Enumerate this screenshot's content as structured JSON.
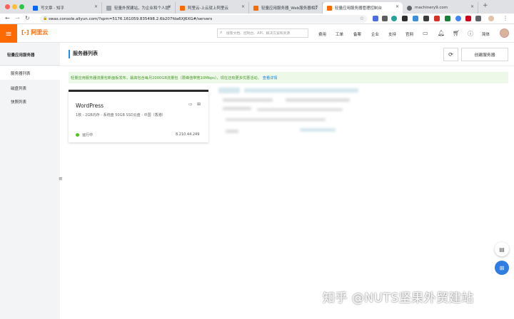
{
  "browser": {
    "tabs": [
      {
        "label": "写文章 - 知乎",
        "fav": "#0066ff"
      },
      {
        "label": "轻量外贸建站，为企业和个人提供...",
        "fav": "#9aa0a6"
      },
      {
        "label": "阿里云-上云就上阿里云",
        "fav": "#ff6a00"
      },
      {
        "label": "轻量应用服务器_Web服务器相关...",
        "fav": "#ff6a00"
      },
      {
        "label": "轻量应用服务器管理控制台",
        "fav": "#ff6a00"
      },
      {
        "label": "machinery9.com",
        "fav": "#5f6368"
      }
    ],
    "url": "swas.console.aliyun.com/?spm=5176.161059.835498.2.6b207fda6XJ6XG#/servers"
  },
  "header": {
    "logo": "阿里云",
    "search_placeholder": "搜索文档、控制台、API、解决方案和资源",
    "links": [
      "费用",
      "工单",
      "备案",
      "企业",
      "支持",
      "官网"
    ],
    "lang": "简体",
    "menu_icon": "≡"
  },
  "sidebar": {
    "title": "轻量应用服务器",
    "items": [
      {
        "label": "服务器列表"
      },
      {
        "label": "磁盘列表"
      },
      {
        "label": "快照列表"
      }
    ]
  },
  "main": {
    "title": "服务器列表",
    "refresh_icon": "⟳",
    "create_button": "创建服务器",
    "notice_text": "轻量应用服务器流量包新面板发布，最高包含每月2000GB流量包（限峰值带宽10Mbps），现在还有更多优惠活动，",
    "notice_link": "查看详情"
  },
  "card": {
    "title": "WordPress",
    "spec": "1核 - 2GB内存 - 系统盘 50GB SSD云盘 - 中国（香港）",
    "status": "运行中",
    "ip": "8.210.44.249"
  },
  "watermark": "知乎 @NUTS坚果外贸建站",
  "colors": {
    "accent": "#ff6a00",
    "primary": "#1890ff",
    "notice_bg": "#edf8e8",
    "running": "#52c41a"
  }
}
